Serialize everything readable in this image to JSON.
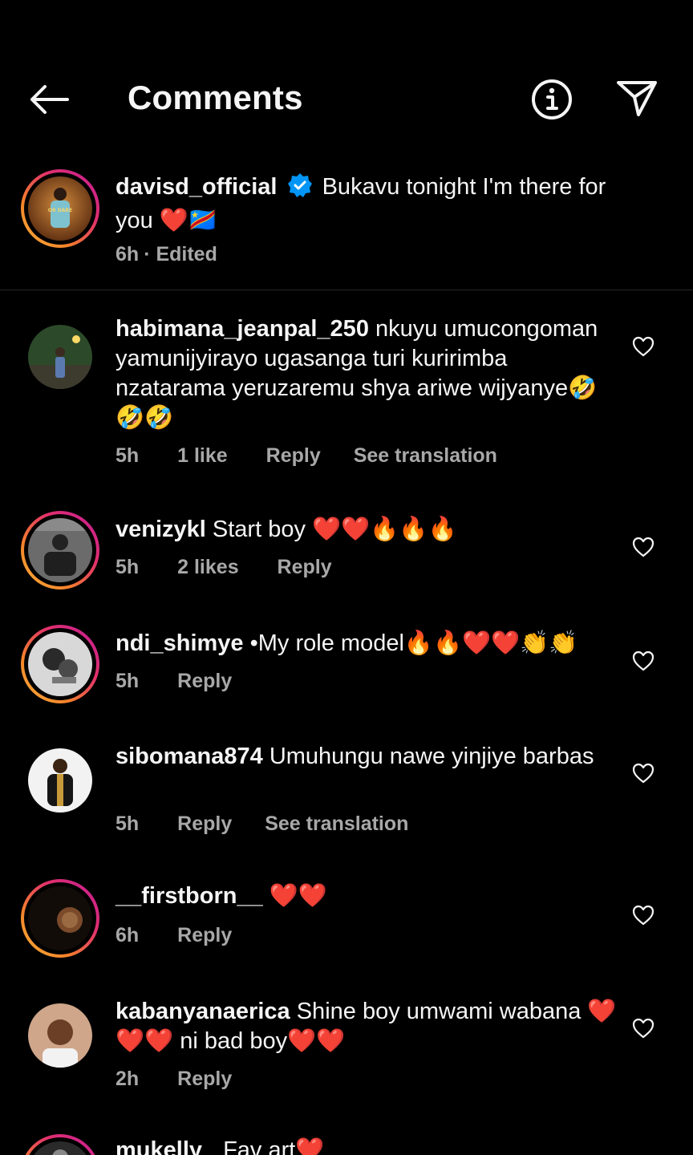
{
  "header": {
    "title": "Comments",
    "back_icon": "arrow-left-icon",
    "info_icon": "info-icon",
    "share_icon": "send-icon"
  },
  "caption": {
    "username": "davisd_official",
    "verified": true,
    "text": "Bukavu tonight I'm there for you ❤️🇨🇩",
    "time": "6h",
    "edited": "· Edited"
  },
  "comments": [
    {
      "username": "habimana_jeanpal_250",
      "text": "nkuyu umucongoman yamunijyirayo ugasanga turi kuririmba nzatarama yeruzaremu shya ariwe wijyanye🤣🤣🤣",
      "time": "5h",
      "likes": "1 like",
      "reply": "Reply",
      "translation": "See translation"
    },
    {
      "username": "venizykl",
      "text": "Start boy ❤️❤️🔥🔥🔥",
      "time": "5h",
      "likes": "2 likes",
      "reply": "Reply"
    },
    {
      "username": "ndi_shimye",
      "text": "•My role model🔥🔥❤️❤️👏👏",
      "time": "5h",
      "reply": "Reply"
    },
    {
      "username": "sibomana874",
      "text": "Umuhungu nawe yinjiye barbas",
      "time": "5h",
      "reply": "Reply",
      "translation": "See translation"
    },
    {
      "username": "__firstborn__",
      "text": " ❤️❤️",
      "time": "6h",
      "reply": "Reply"
    },
    {
      "username": "kabanyanaerica",
      "text": "Shine boy umwami wabana ❤️❤️❤️ ni bad boy❤️❤️",
      "time": "2h",
      "reply": "Reply"
    },
    {
      "username": "mukelly",
      "text": "Fav art❤️"
    }
  ],
  "colors": {
    "background": "#000000",
    "text": "#f5f5f5",
    "secondary": "#a8a8a8",
    "verified": "#0095f6",
    "divider": "#262626"
  }
}
